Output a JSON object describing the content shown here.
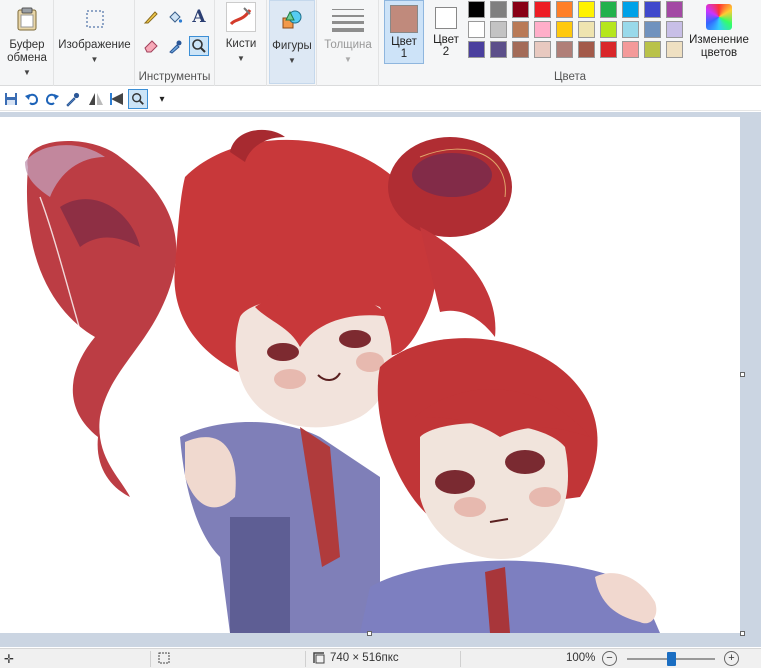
{
  "ribbon": {
    "clipboard": {
      "label_line1": "Буфер",
      "label_line2": "обмена"
    },
    "image": {
      "label": "Изображение"
    },
    "tools": {
      "group_label": "Инструменты"
    },
    "brushes": {
      "label": "Кисти"
    },
    "shapes": {
      "label": "Фигуры"
    },
    "thickness": {
      "label": "Толщина"
    },
    "color1": {
      "label": "Цвет",
      "number": "1",
      "value": "#c08a7c"
    },
    "color2": {
      "label": "Цвет",
      "number": "2",
      "value": "#ffffff"
    },
    "colors": {
      "group_label": "Цвета"
    },
    "edit_colors": {
      "label_line1": "Изменение",
      "label_line2": "цветов"
    },
    "palette": [
      "#000000",
      "#7f7f7f",
      "#880015",
      "#ed1c24",
      "#ff7f27",
      "#fff200",
      "#22b14c",
      "#00a2e8",
      "#3f48cc",
      "#a349a4",
      "#ffffff",
      "#c3c3c3",
      "#b97a57",
      "#ffaec9",
      "#ffc90e",
      "#efe4b0",
      "#b5e61d",
      "#99d9ea",
      "#7092be",
      "#c8bfe7",
      "#4a3f9e",
      "#5c4f8a",
      "#a36b58",
      "#e8c9c0",
      "#b07f78",
      "#a35a4a",
      "#d9262a",
      "#f39a9a",
      "#b9c24a",
      "#efe0c2"
    ]
  },
  "status": {
    "dimensions": "740 × 516пкс",
    "zoom": "100%",
    "zoom_minus": "−",
    "zoom_plus": "+",
    "zoom_level": 0.5
  }
}
